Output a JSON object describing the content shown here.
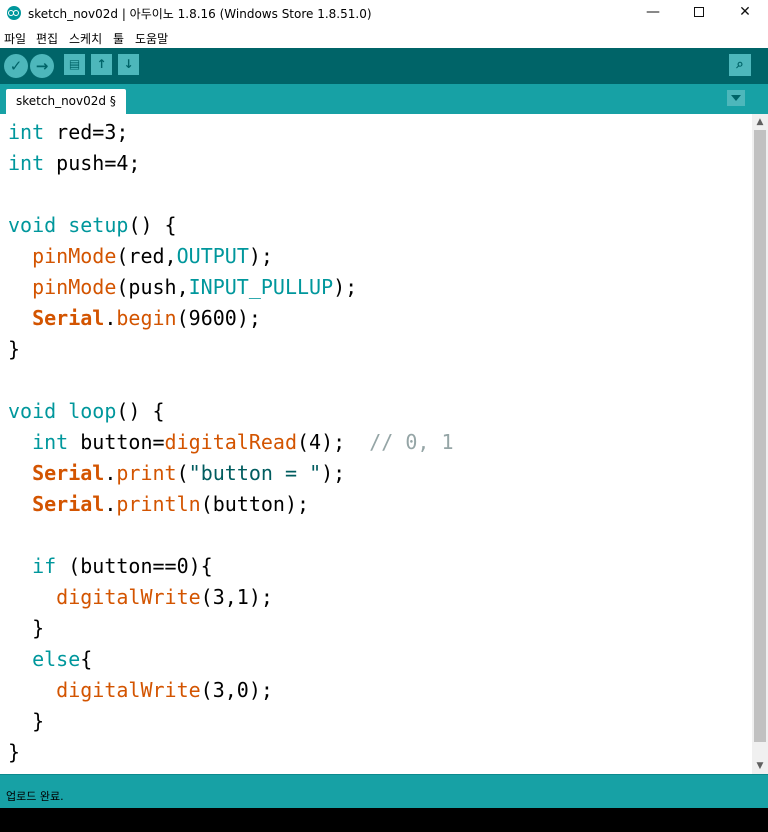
{
  "window": {
    "title": "sketch_nov02d | 아두이노 1.8.16 (Windows Store 1.8.51.0)",
    "minimize_glyph": "—",
    "close_glyph": "✕"
  },
  "menu": {
    "items": [
      "파일",
      "편집",
      "스케치",
      "툴",
      "도움말"
    ]
  },
  "toolbar": {
    "verify_glyph": "✓",
    "upload_glyph": "→",
    "new_glyph": "▤",
    "open_glyph": "↑",
    "save_glyph": "↓",
    "serial_glyph": "⌕",
    "icons": [
      "checkmark-icon",
      "arrow-right-icon",
      "new-file-icon",
      "open-arrow-up-icon",
      "save-arrow-down-icon",
      "magnifier-icon"
    ]
  },
  "tab": {
    "label": "sketch_nov02d §"
  },
  "code": {
    "lines": [
      [
        {
          "t": "int",
          "c": "kw"
        },
        {
          "t": " red=3;",
          "c": ""
        }
      ],
      [
        {
          "t": "int",
          "c": "kw"
        },
        {
          "t": " push=4;",
          "c": ""
        }
      ],
      [],
      [
        {
          "t": "void",
          "c": "kw"
        },
        {
          "t": " ",
          "c": ""
        },
        {
          "t": "setup",
          "c": "kw"
        },
        {
          "t": "() {",
          "c": ""
        }
      ],
      [
        {
          "t": "  ",
          "c": ""
        },
        {
          "t": "pinMode",
          "c": "fn"
        },
        {
          "t": "(red,",
          "c": ""
        },
        {
          "t": "OUTPUT",
          "c": "kw"
        },
        {
          "t": ");",
          "c": ""
        }
      ],
      [
        {
          "t": "  ",
          "c": ""
        },
        {
          "t": "pinMode",
          "c": "fn"
        },
        {
          "t": "(push,",
          "c": ""
        },
        {
          "t": "INPUT_PULLUP",
          "c": "kw"
        },
        {
          "t": ");",
          "c": ""
        }
      ],
      [
        {
          "t": "  ",
          "c": ""
        },
        {
          "t": "Serial",
          "c": "cls"
        },
        {
          "t": ".",
          "c": ""
        },
        {
          "t": "begin",
          "c": "fn"
        },
        {
          "t": "(9600);",
          "c": ""
        }
      ],
      [
        {
          "t": "}",
          "c": ""
        }
      ],
      [],
      [
        {
          "t": "void",
          "c": "kw"
        },
        {
          "t": " ",
          "c": ""
        },
        {
          "t": "loop",
          "c": "kw"
        },
        {
          "t": "() {",
          "c": ""
        }
      ],
      [
        {
          "t": "  ",
          "c": ""
        },
        {
          "t": "int",
          "c": "kw"
        },
        {
          "t": " button=",
          "c": ""
        },
        {
          "t": "digitalRead",
          "c": "fn"
        },
        {
          "t": "(4);  ",
          "c": ""
        },
        {
          "t": "// 0, 1",
          "c": "cm"
        }
      ],
      [
        {
          "t": "  ",
          "c": ""
        },
        {
          "t": "Serial",
          "c": "cls"
        },
        {
          "t": ".",
          "c": ""
        },
        {
          "t": "print",
          "c": "fn"
        },
        {
          "t": "(",
          "c": ""
        },
        {
          "t": "\"button = \"",
          "c": "str"
        },
        {
          "t": ");",
          "c": ""
        }
      ],
      [
        {
          "t": "  ",
          "c": ""
        },
        {
          "t": "Serial",
          "c": "cls"
        },
        {
          "t": ".",
          "c": ""
        },
        {
          "t": "println",
          "c": "fn"
        },
        {
          "t": "(button);",
          "c": ""
        }
      ],
      [],
      [
        {
          "t": "  ",
          "c": ""
        },
        {
          "t": "if",
          "c": "kw"
        },
        {
          "t": " (button==0){",
          "c": ""
        }
      ],
      [
        {
          "t": "    ",
          "c": ""
        },
        {
          "t": "digitalWrite",
          "c": "fn"
        },
        {
          "t": "(3,1);",
          "c": ""
        }
      ],
      [
        {
          "t": "  }",
          "c": ""
        }
      ],
      [
        {
          "t": "  ",
          "c": ""
        },
        {
          "t": "else",
          "c": "kw"
        },
        {
          "t": "{",
          "c": ""
        }
      ],
      [
        {
          "t": "    ",
          "c": ""
        },
        {
          "t": "digitalWrite",
          "c": "fn"
        },
        {
          "t": "(3,0);",
          "c": ""
        }
      ],
      [
        {
          "t": "  }",
          "c": ""
        }
      ],
      [
        {
          "t": "}",
          "c": ""
        }
      ]
    ]
  },
  "scrollbar": {
    "up_glyph": "▲",
    "down_glyph": "▼"
  },
  "status": {
    "message": "업로드 완료."
  },
  "colors": {
    "toolbar": "#006468",
    "tabbar": "#17a1a5",
    "keyword": "#00979c",
    "function": "#d35400",
    "comment": "#95a5a6"
  }
}
